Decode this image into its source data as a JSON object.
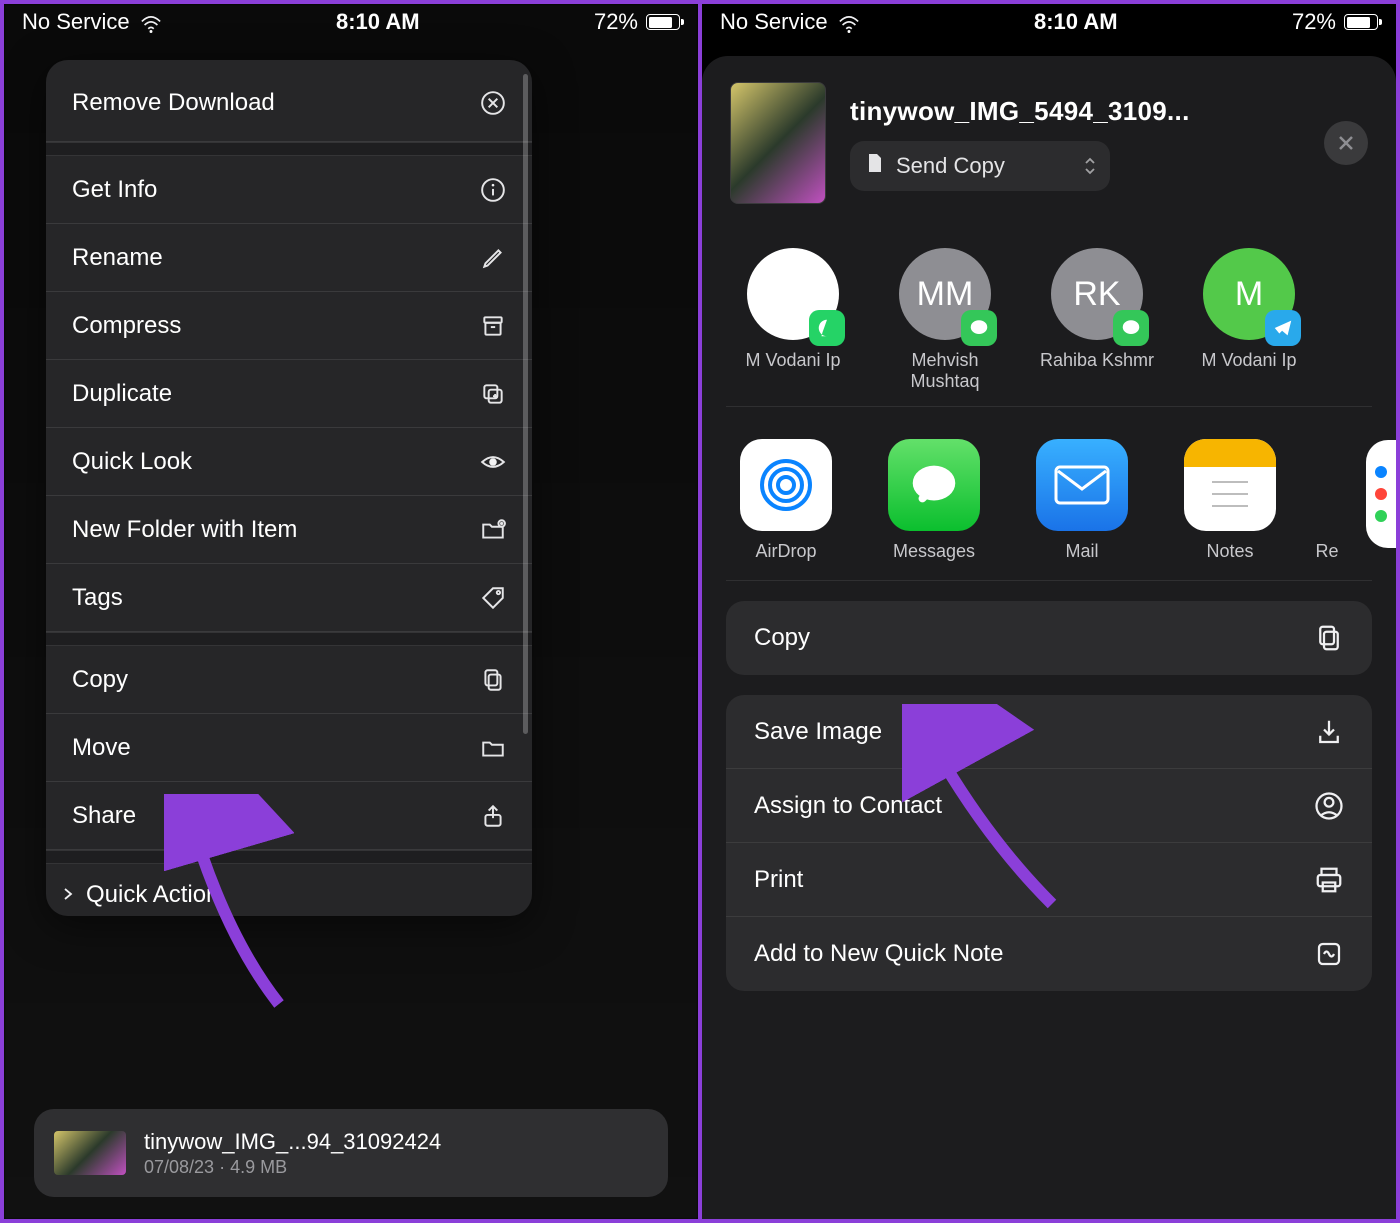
{
  "status": {
    "carrier": "No Service",
    "time": "8:10 AM",
    "battery_pct": "72%"
  },
  "left": {
    "menu": {
      "remove_download": "Remove Download",
      "get_info": "Get Info",
      "rename": "Rename",
      "compress": "Compress",
      "duplicate": "Duplicate",
      "quick_look": "Quick Look",
      "new_folder": "New Folder with Item",
      "tags": "Tags",
      "copy": "Copy",
      "move": "Move",
      "share": "Share",
      "quick_actions": "Quick Action"
    },
    "file": {
      "name": "tinywow_IMG_...94_31092424",
      "subtitle": "07/08/23 · 4.9 MB"
    }
  },
  "right": {
    "filename": "tinywow_IMG_5494_3109...",
    "send_mode": "Send Copy",
    "contacts": [
      {
        "name": "M Vodani Ip",
        "initials": "",
        "color": "white",
        "badge": "whatsapp"
      },
      {
        "name": "Mehvish Mushtaq",
        "initials": "MM",
        "color": "grey",
        "badge": "imessage"
      },
      {
        "name": "Rahiba Kshmr",
        "initials": "RK",
        "color": "grey",
        "badge": "imessage"
      },
      {
        "name": "M Vodani Ip",
        "initials": "M",
        "color": "green",
        "badge": "telegram"
      }
    ],
    "apps": {
      "airdrop": "AirDrop",
      "messages": "Messages",
      "mail": "Mail",
      "notes": "Notes",
      "reminders": "Re"
    },
    "actions": {
      "copy": "Copy",
      "save_image": "Save Image",
      "assign_contact": "Assign to Contact",
      "print": "Print",
      "quick_note": "Add to New Quick Note"
    }
  }
}
